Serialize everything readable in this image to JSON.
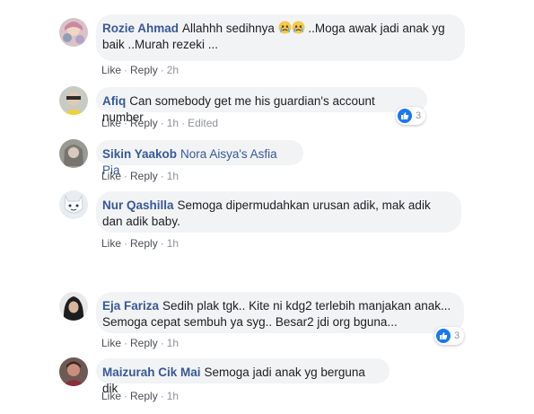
{
  "actions": {
    "like": "Like",
    "reply": "Reply",
    "separator": "·",
    "edited": "Edited"
  },
  "comments": [
    {
      "author": "Rozie Ahmad",
      "text_before": "Allahhh sedihnya ",
      "emoji": "crying-face-icon",
      "text_after": " ..Moga awak jadi anak yg baik ..Murah rezeki ...",
      "time": "2h"
    },
    {
      "author": "Afiq",
      "text": "Can somebody get me his guardian's account number",
      "time": "1h",
      "edited": true,
      "reactions": {
        "icon": "like-icon",
        "count": "3"
      }
    },
    {
      "author": "Sikin Yaakob",
      "tag": "Nora Aisya's Asfia Pia",
      "time": "1h"
    },
    {
      "author": "Nur Qashilla",
      "text": "Semoga dipermudahkan urusan adik, mak adik dan adik baby.",
      "time": "1h"
    },
    {
      "author": "Eja Fariza",
      "text": "Sedih plak tgk.. Kite ni kdg2 terlebih manjakan anak... Semoga cepat sembuh ya syg.. Besar2 jdi org bguna...",
      "time": "1h",
      "reactions": {
        "icon": "like-icon",
        "count": "3"
      }
    },
    {
      "author": "Maizurah Cik Mai",
      "text": "Semoga jadi anak yg berguna dik",
      "time": "1h"
    }
  ]
}
